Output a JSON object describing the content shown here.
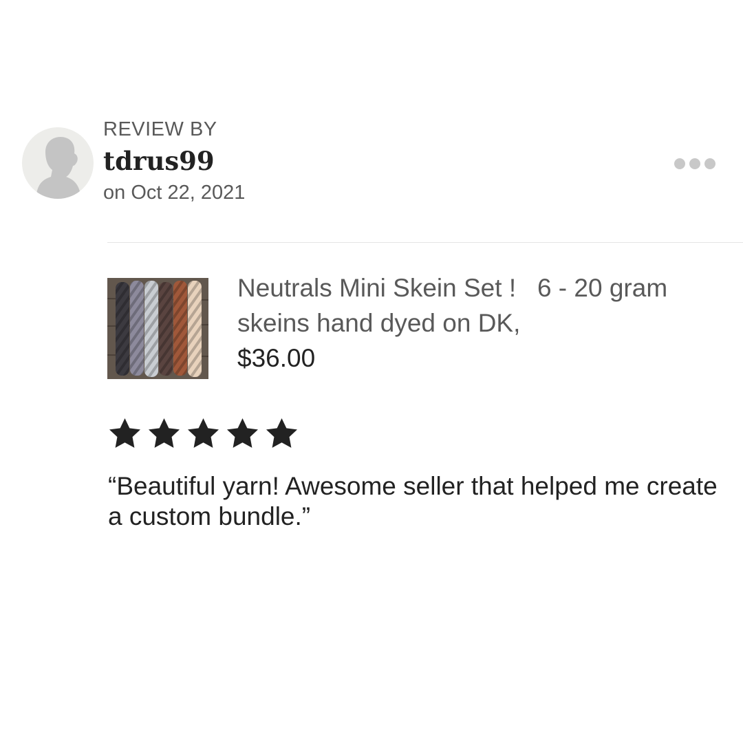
{
  "review": {
    "label": "REVIEW BY",
    "username": "tdrus99",
    "date": "on Oct 22, 2021",
    "avatar_icon": "default-user-silhouette-icon",
    "more_icon": "more-horizontal-icon",
    "rating": 5,
    "max_rating": 5,
    "text": "“Beautiful yarn! Awesome seller that helped me create a custom bundle.”"
  },
  "product": {
    "title": "Neutrals Mini Skein Set !   6 - 20 gram skeins hand dyed on DK,",
    "price": "$36.00",
    "image_icon": "yarn-skeins-thumbnail"
  },
  "colors": {
    "background": "#ffffff",
    "text_primary": "#222222",
    "text_secondary": "#595959",
    "divider": "#e4e4e4",
    "dots": "#c8c8c8",
    "star": "#222222",
    "avatar_bg": "#ededea",
    "avatar_figure": "#c4c4c4"
  }
}
